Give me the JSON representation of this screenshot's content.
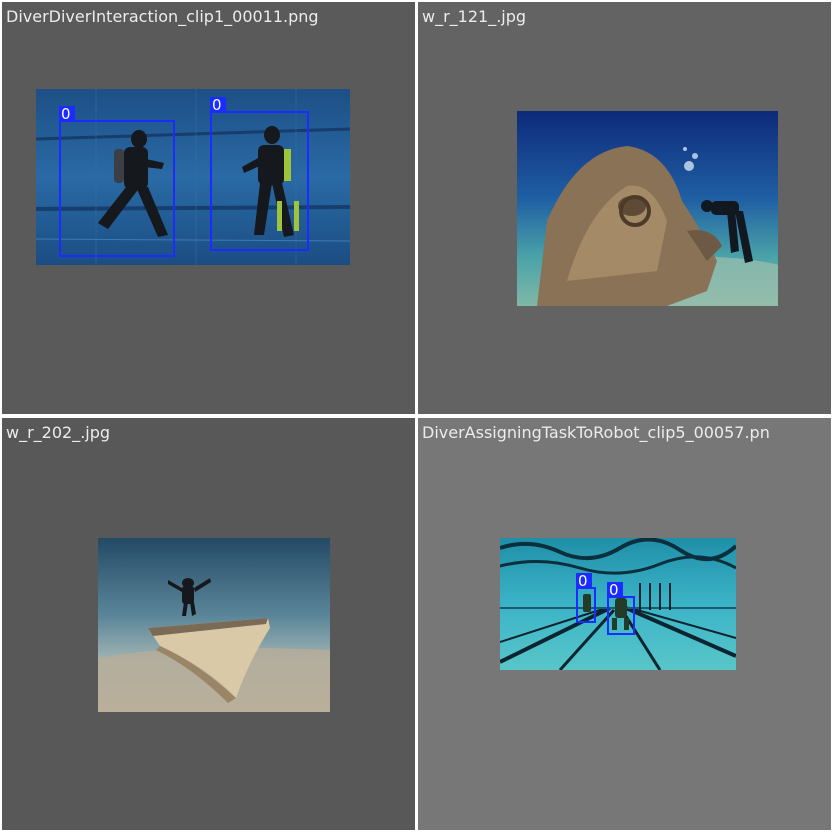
{
  "grid": {
    "cells": [
      {
        "title": "DiverDiverInteraction_clip1_00011.png",
        "background": "#5a5a5a",
        "scene": "pool-two-divers",
        "detections": [
          {
            "label": "0"
          },
          {
            "label": "0"
          }
        ]
      },
      {
        "title": "w_r_121_.jpg",
        "background": "#636363",
        "scene": "wreck-with-diver",
        "detections": []
      },
      {
        "title": "w_r_202_.jpg",
        "background": "#585858",
        "scene": "boat-wreck-seabed",
        "detections": []
      },
      {
        "title": "DiverAssigningTaskToRobot_clip5_00057.pn",
        "background": "#777777",
        "scene": "pool-lanes-divers",
        "detections": [
          {
            "label": "0"
          },
          {
            "label": "0"
          }
        ]
      }
    ]
  },
  "colors": {
    "bbox": "#1a2cff",
    "title_text": "#ececec",
    "divider": "#ffffff"
  }
}
